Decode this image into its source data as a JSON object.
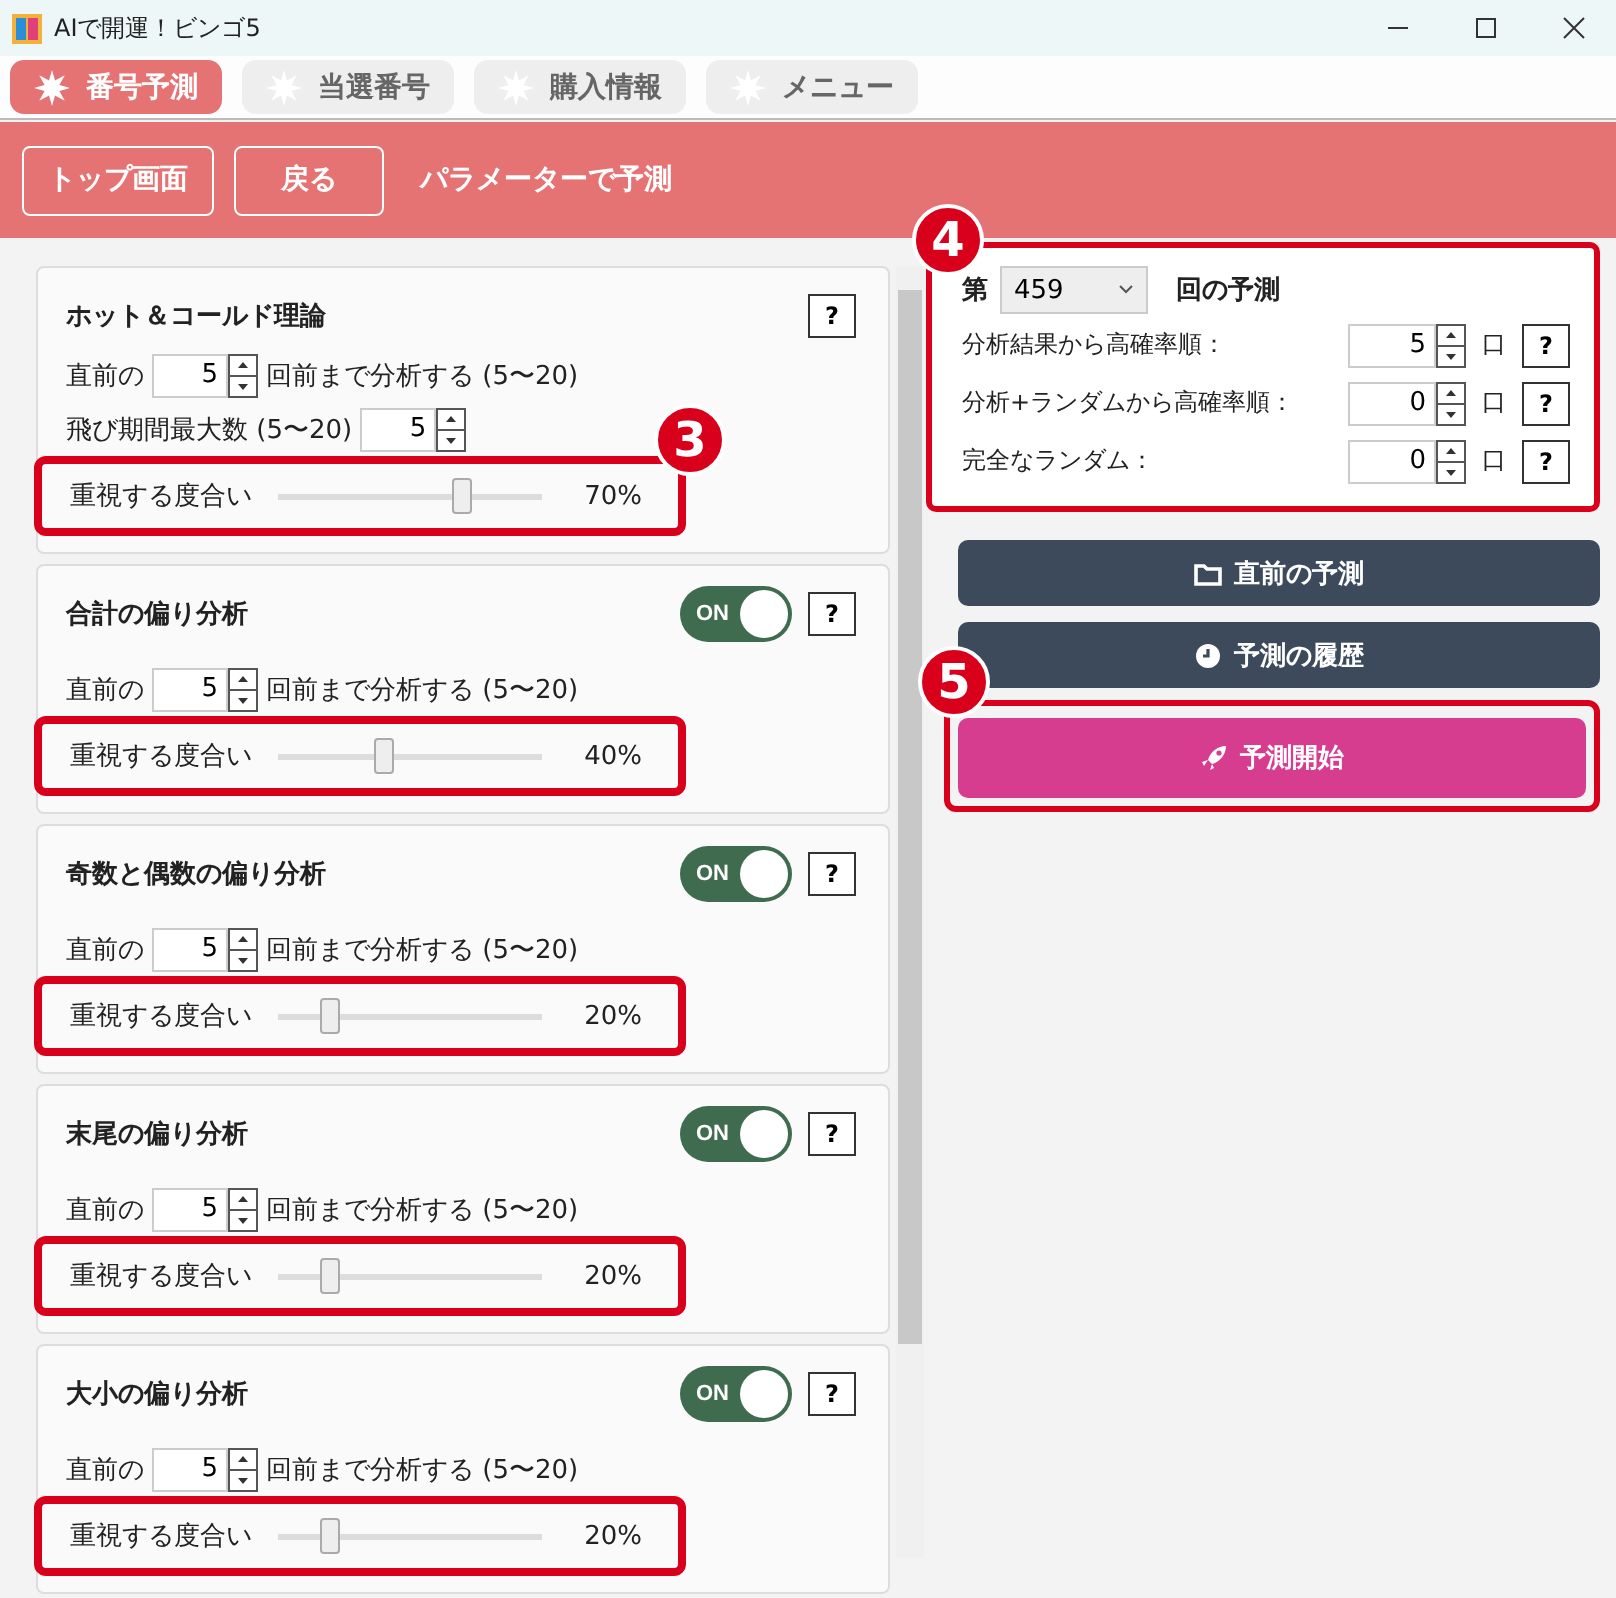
{
  "window": {
    "title": "AIで開運！ビンゴ5"
  },
  "tabs": [
    {
      "label": "番号予測",
      "selected": true
    },
    {
      "label": "当選番号",
      "selected": false
    },
    {
      "label": "購入情報",
      "selected": false
    },
    {
      "label": "メニュー",
      "selected": false
    }
  ],
  "header": {
    "buttons": [
      "トップ画面",
      "戻る"
    ],
    "title": "パラメーターで予測"
  },
  "panels": [
    {
      "title": "ホット＆コールド理論",
      "help": "?",
      "rows": [
        {
          "before": "直前の",
          "value": "5",
          "after": "回前まで分析する (5〜20)"
        },
        {
          "before": "飛び期間最大数 (5〜20)",
          "value": "5"
        }
      ],
      "weight": {
        "label": "重視する度合い",
        "level": 0.7,
        "reading": "70%",
        "highlighted": true,
        "callout": "3"
      }
    },
    {
      "title": "合計の偏り分析",
      "toggle": {
        "label": "ON",
        "on": true
      },
      "help": "?",
      "rows": [
        {
          "before": "直前の",
          "value": "5",
          "after": "回前まで分析する (5〜20)"
        }
      ],
      "weight": {
        "label": "重視する度合い",
        "level": 0.4,
        "reading": "40%",
        "highlighted": true
      }
    },
    {
      "title": "奇数と偶数の偏り分析",
      "toggle": {
        "label": "ON",
        "on": true
      },
      "help": "?",
      "rows": [
        {
          "before": "直前の",
          "value": "5",
          "after": "回前まで分析する (5〜20)"
        }
      ],
      "weight": {
        "label": "重視する度合い",
        "level": 0.2,
        "reading": "20%",
        "highlighted": true
      }
    },
    {
      "title": "末尾の偏り分析",
      "toggle": {
        "label": "ON",
        "on": true
      },
      "help": "?",
      "rows": [
        {
          "before": "直前の",
          "value": "5",
          "after": "回前まで分析する (5〜20)"
        }
      ],
      "weight": {
        "label": "重視する度合い",
        "level": 0.2,
        "reading": "20%",
        "highlighted": true
      }
    },
    {
      "title": "大小の偏り分析",
      "toggle": {
        "label": "ON",
        "on": true
      },
      "help": "?",
      "rows": [
        {
          "before": "直前の",
          "value": "5",
          "after": "回前まで分析する (5〜20)"
        }
      ],
      "weight": {
        "label": "重視する度合い",
        "level": 0.2,
        "reading": "20%",
        "highlighted": true
      }
    }
  ],
  "prediction": {
    "prefix": "第",
    "draw": "459",
    "suffix": "回の予測",
    "highlighted": true,
    "callout": "4",
    "rows": [
      {
        "label": "分析結果から高確率順：",
        "value": "5",
        "unit": "口",
        "help": "?"
      },
      {
        "label": "分析+ランダムから高確率順：",
        "value": "0",
        "unit": "口",
        "help": "?"
      },
      {
        "label": "完全なランダム：",
        "value": "0",
        "unit": "口",
        "help": "?"
      }
    ]
  },
  "actions": [
    {
      "label": "直前の予測",
      "kind": "secondary"
    },
    {
      "label": "予測の履歴",
      "kind": "secondary"
    },
    {
      "label": "予測開始",
      "kind": "primary",
      "highlighted": true,
      "callout": "5"
    }
  ]
}
